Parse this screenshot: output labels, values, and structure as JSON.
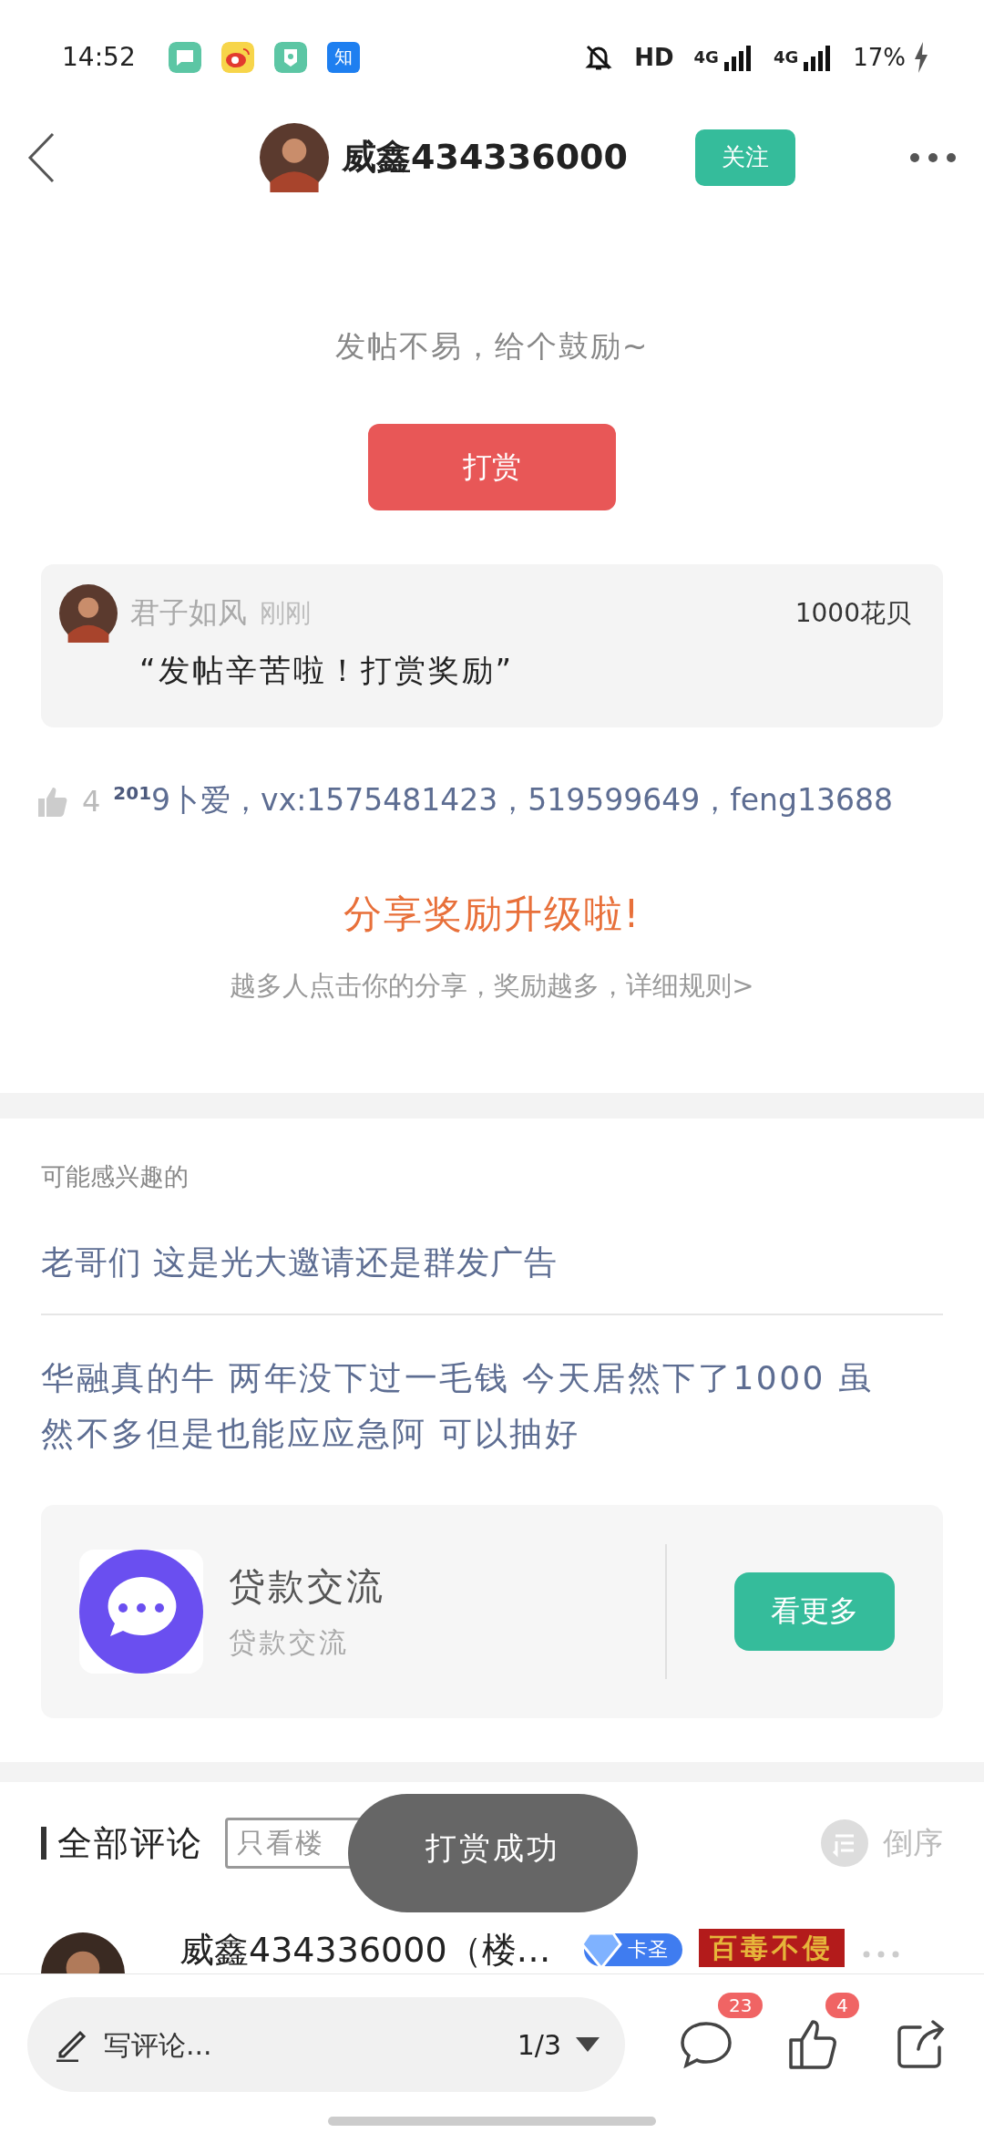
{
  "status_bar": {
    "time": "14:52",
    "notifications": [
      {
        "kind": "message"
      },
      {
        "kind": "weibo"
      },
      {
        "kind": "wallet"
      },
      {
        "kind": "zhihu",
        "label": "知"
      }
    ],
    "hd": "HD",
    "signal_1": "4G",
    "signal_2": "4G",
    "battery": "17%"
  },
  "header": {
    "username": "威鑫434336000",
    "follow_button": "关注"
  },
  "reward": {
    "prompt": "发帖不易，给个鼓励~",
    "button": "打赏",
    "entries": [
      {
        "name": "君子如风",
        "time": "刚刚",
        "amount": "1000花贝",
        "message": "“发帖辛苦啦！打赏奖励”"
      }
    ]
  },
  "signature": {
    "likes": "4",
    "text": "$^{201}$9卜爱，vx:1575481423，519599649，feng13688"
  },
  "share_promo": {
    "title": "分享奖励升级啦!",
    "subtitle": "越多人点击你的分享，奖励越多，详细规则>"
  },
  "related": {
    "title": "可能感兴趣的",
    "posts": [
      "老哥们 这是光大邀请还是群发广告",
      "华融真的牛 两年没下过一毛钱 今天居然下了1000 虽然不多但是也能应应急阿 可以抽好"
    ],
    "group": {
      "name": "贷款交流",
      "description": "贷款交流",
      "button": "看更多"
    }
  },
  "comments": {
    "title": "全部评论",
    "filter_button": "只看楼",
    "sort_button": "倒序",
    "items": [
      {
        "author": "威鑫434336000（楼…",
        "level_badge": "卡圣",
        "title_badge": "百毒不侵"
      }
    ]
  },
  "toast": "打赏成功",
  "bottom_bar": {
    "placeholder": "写评论...",
    "page": "1/3",
    "comment_count": "23",
    "like_count": "4"
  }
}
